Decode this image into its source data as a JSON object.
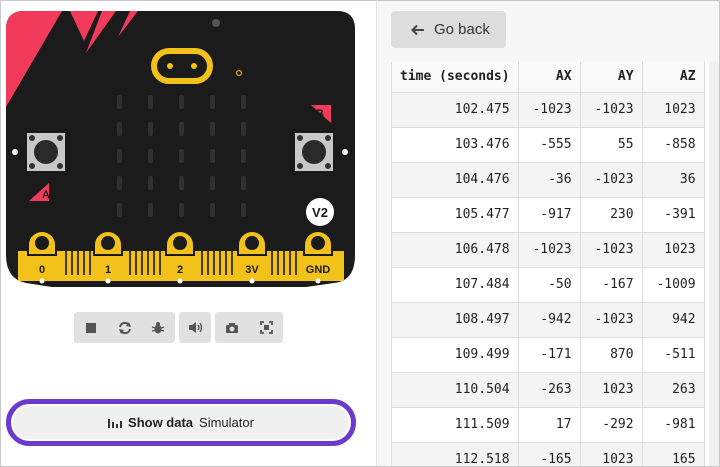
{
  "simulator": {
    "board_version": "V2",
    "button_a_label": "A",
    "button_b_label": "B",
    "pins": [
      "0",
      "1",
      "2",
      "3V",
      "GND"
    ],
    "board_color": "#1b1b1b",
    "accent_red": "#f23a5a",
    "pin_gold": "#f2c21b",
    "controls": [
      {
        "name": "stop-button",
        "icon": "stop-icon"
      },
      {
        "name": "restart-button",
        "icon": "restart-icon"
      },
      {
        "name": "debug-button",
        "icon": "bug-icon"
      },
      {
        "name": "sound-button",
        "icon": "speaker-icon"
      },
      {
        "name": "screenshot-button",
        "icon": "camera-icon"
      },
      {
        "name": "fullscreen-button",
        "icon": "fullscreen-icon"
      }
    ]
  },
  "show_data": {
    "label": "Show data",
    "source": "Simulator",
    "highlight_color": "#6b3bd0"
  },
  "go_back": {
    "label": "Go back"
  },
  "table": {
    "headers": [
      "time (seconds)",
      "AX",
      "AY",
      "AZ"
    ],
    "rows": [
      [
        "102.475",
        "-1023",
        "-1023",
        "1023"
      ],
      [
        "103.476",
        "-555",
        "55",
        "-858"
      ],
      [
        "104.476",
        "-36",
        "-1023",
        "36"
      ],
      [
        "105.477",
        "-917",
        "230",
        "-391"
      ],
      [
        "106.478",
        "-1023",
        "-1023",
        "1023"
      ],
      [
        "107.484",
        "-50",
        "-167",
        "-1009"
      ],
      [
        "108.497",
        "-942",
        "-1023",
        "942"
      ],
      [
        "109.499",
        "-171",
        "870",
        "-511"
      ],
      [
        "110.504",
        "-263",
        "1023",
        "263"
      ],
      [
        "111.509",
        "17",
        "-292",
        "-981"
      ],
      [
        "112.518",
        "-165",
        "1023",
        "165"
      ]
    ]
  }
}
